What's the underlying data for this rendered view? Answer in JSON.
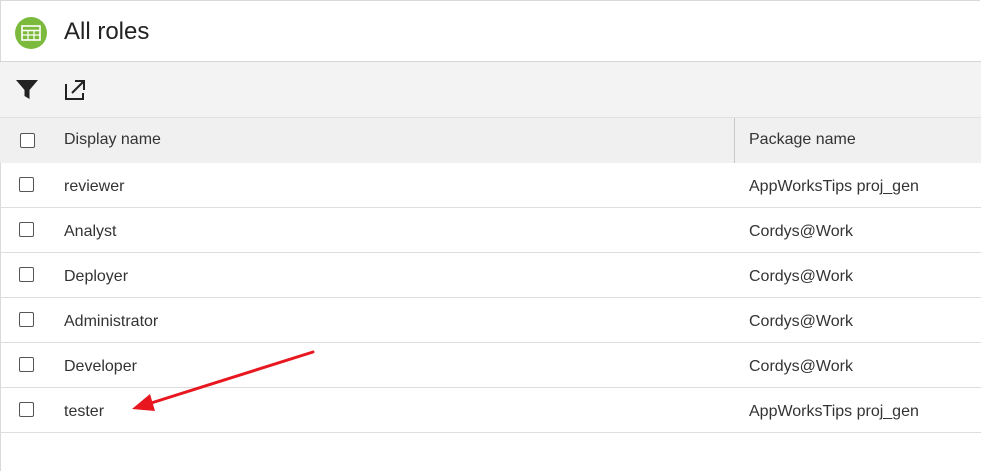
{
  "header": {
    "title": "All roles",
    "icon": "table-icon",
    "icon_color": "#7cba3d"
  },
  "toolbar": {
    "filter_icon": "filter-icon",
    "export_icon": "open-external-icon"
  },
  "table": {
    "columns": [
      "Display name",
      "Package name"
    ],
    "rows": [
      {
        "display_name": "reviewer",
        "package_name": "AppWorksTips proj_gen"
      },
      {
        "display_name": "Analyst",
        "package_name": "Cordys@Work"
      },
      {
        "display_name": "Deployer",
        "package_name": "Cordys@Work"
      },
      {
        "display_name": "Administrator",
        "package_name": "Cordys@Work"
      },
      {
        "display_name": "Developer",
        "package_name": "Cordys@Work"
      },
      {
        "display_name": "tester",
        "package_name": "AppWorksTips proj_gen"
      }
    ]
  },
  "annotation": {
    "arrow_color": "#e8171f",
    "points_to": "tester"
  }
}
